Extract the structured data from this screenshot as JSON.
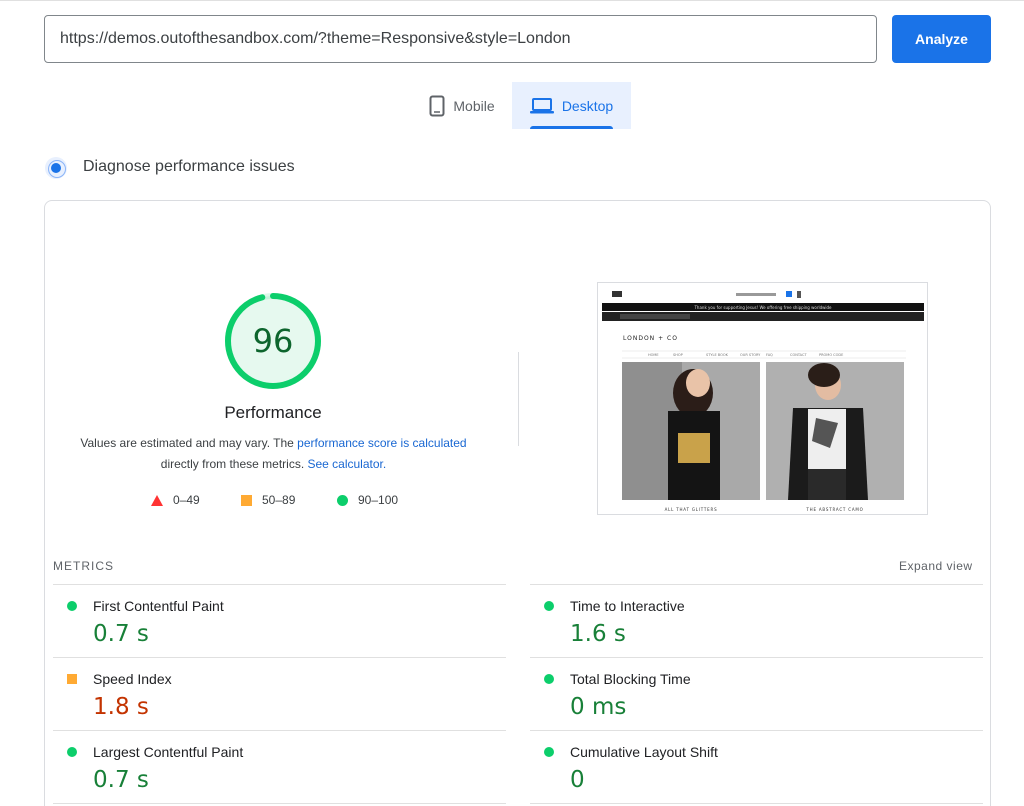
{
  "url_input": {
    "value": "https://demos.outofthesandbox.com/?theme=Responsive&style=London"
  },
  "analyze_label": "Analyze",
  "tabs": [
    {
      "label": "Mobile",
      "active": false
    },
    {
      "label": "Desktop",
      "active": true
    }
  ],
  "section_title": "Diagnose performance issues",
  "score": {
    "value": "96",
    "fraction": 0.96,
    "label": "Performance",
    "color": "#0cce6b"
  },
  "description": {
    "part1": "Values are estimated and may vary. The ",
    "link1": "performance score is calculated",
    "part2": "directly from these metrics. ",
    "link2": "See calculator."
  },
  "legend": [
    {
      "range": "0–49",
      "shape": "triangle-icon",
      "color": "#ff3333"
    },
    {
      "range": "50–89",
      "shape": "square-icon",
      "color": "#ffaa33"
    },
    {
      "range": "90–100",
      "shape": "circle-icon",
      "color": "#0cce6b"
    }
  ],
  "screenshot": {
    "header_text": "Thank you for supporting Jesus! We offering free shipping worldwide",
    "logo": "LONDON + CO",
    "nav": [
      "HOME",
      "SHOP",
      "STYLE BOOK",
      "OUR STORY",
      "FAQ",
      "CONTACT",
      "PROMO CODE"
    ],
    "captions": [
      "ALL THAT GLITTERS",
      "THE ABSTRACT CAMO"
    ]
  },
  "metrics_title": "METRICS",
  "expand_label": "Expand view",
  "metrics": [
    {
      "name": "First Contentful Paint",
      "value": "0.7 s",
      "rating": "good"
    },
    {
      "name": "Time to Interactive",
      "value": "1.6 s",
      "rating": "good"
    },
    {
      "name": "Speed Index",
      "value": "1.8 s",
      "rating": "average"
    },
    {
      "name": "Total Blocking Time",
      "value": "0 ms",
      "rating": "good"
    },
    {
      "name": "Largest Contentful Paint",
      "value": "0.7 s",
      "rating": "good"
    },
    {
      "name": "Cumulative Layout Shift",
      "value": "0",
      "rating": "good"
    }
  ]
}
